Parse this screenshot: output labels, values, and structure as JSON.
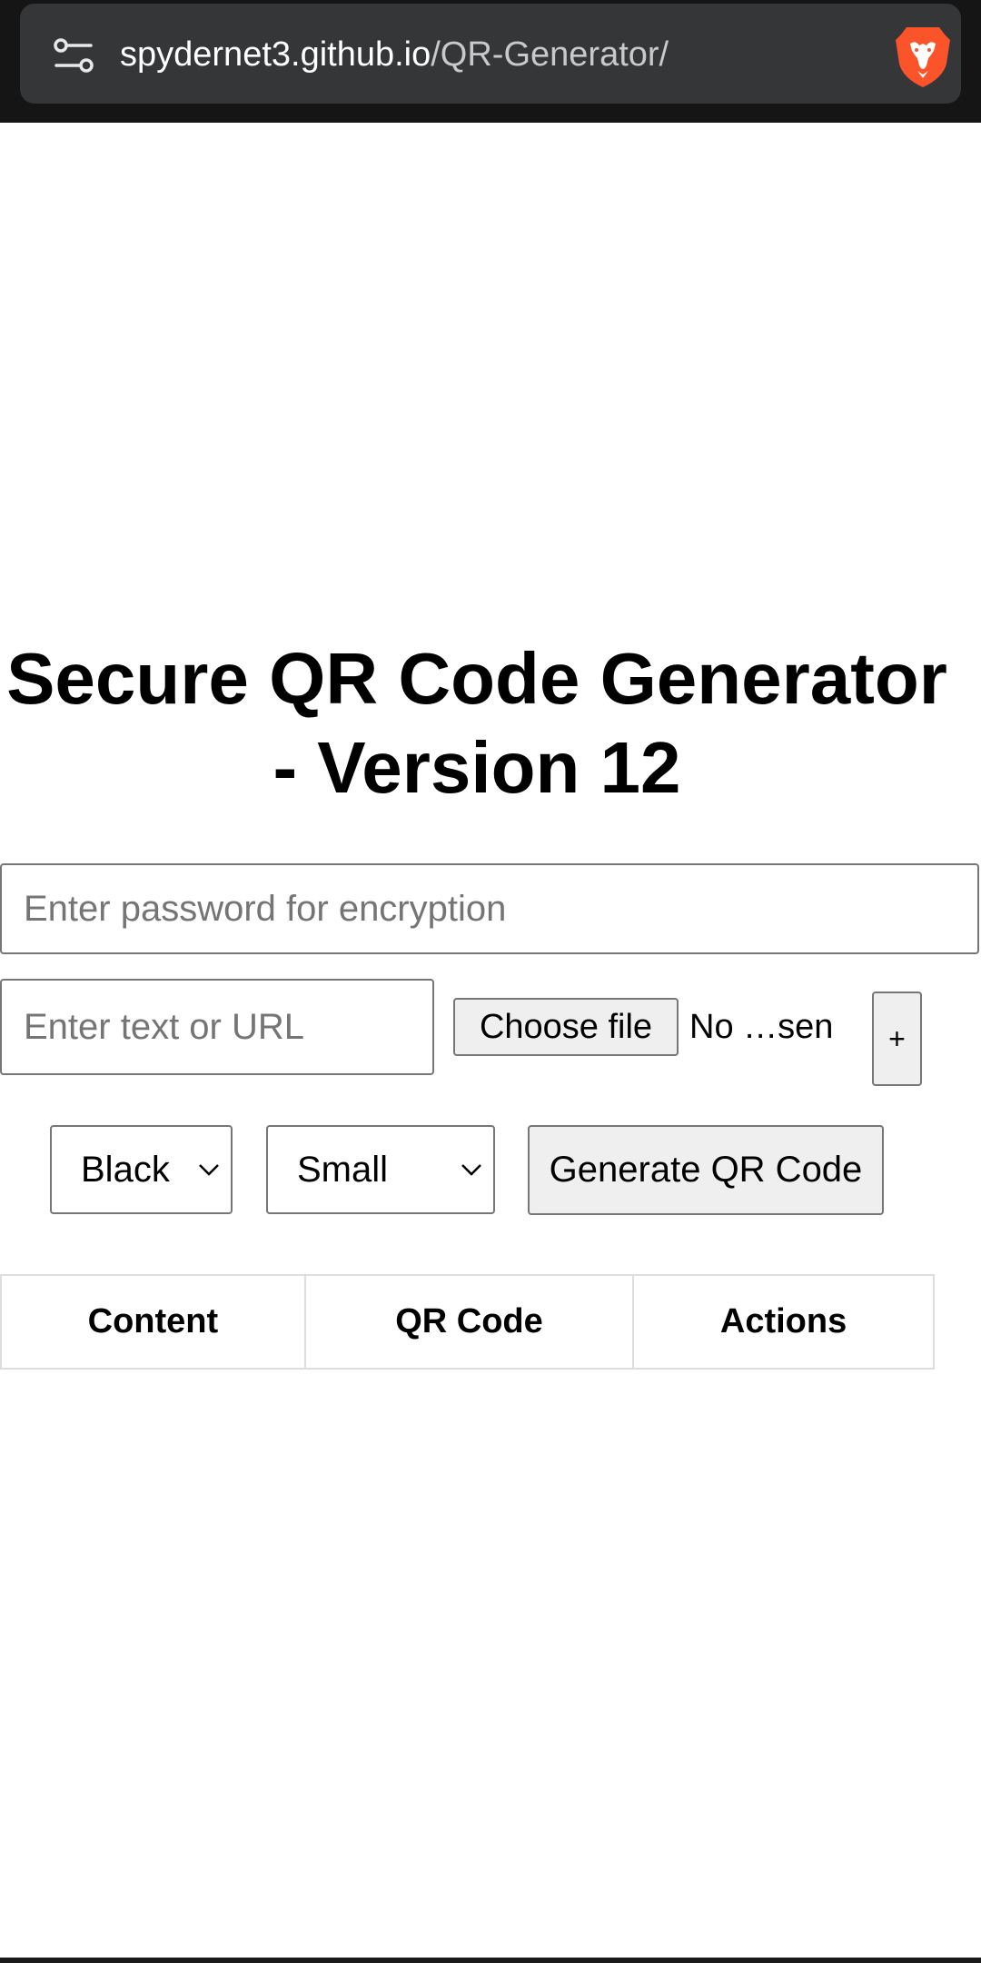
{
  "browser": {
    "url_host": "spydernet3.github.io",
    "url_path": "/QR-Generator/",
    "site_settings_icon": "tune-icon",
    "brand_icon": "brave-lion-icon",
    "brand_color": "#fb542b"
  },
  "page": {
    "title": "Secure QR Code Generator - Version 12",
    "password_placeholder": "Enter password for encryption",
    "text_placeholder": "Enter text or URL",
    "choose_file_label": "Choose file",
    "no_file_text": "No …sen",
    "add_button_label": "+",
    "color_select_value": "Black",
    "size_select_value": "Small",
    "generate_button_label": "Generate QR Code",
    "table_headers": [
      "Content",
      "QR Code",
      "Actions"
    ]
  }
}
